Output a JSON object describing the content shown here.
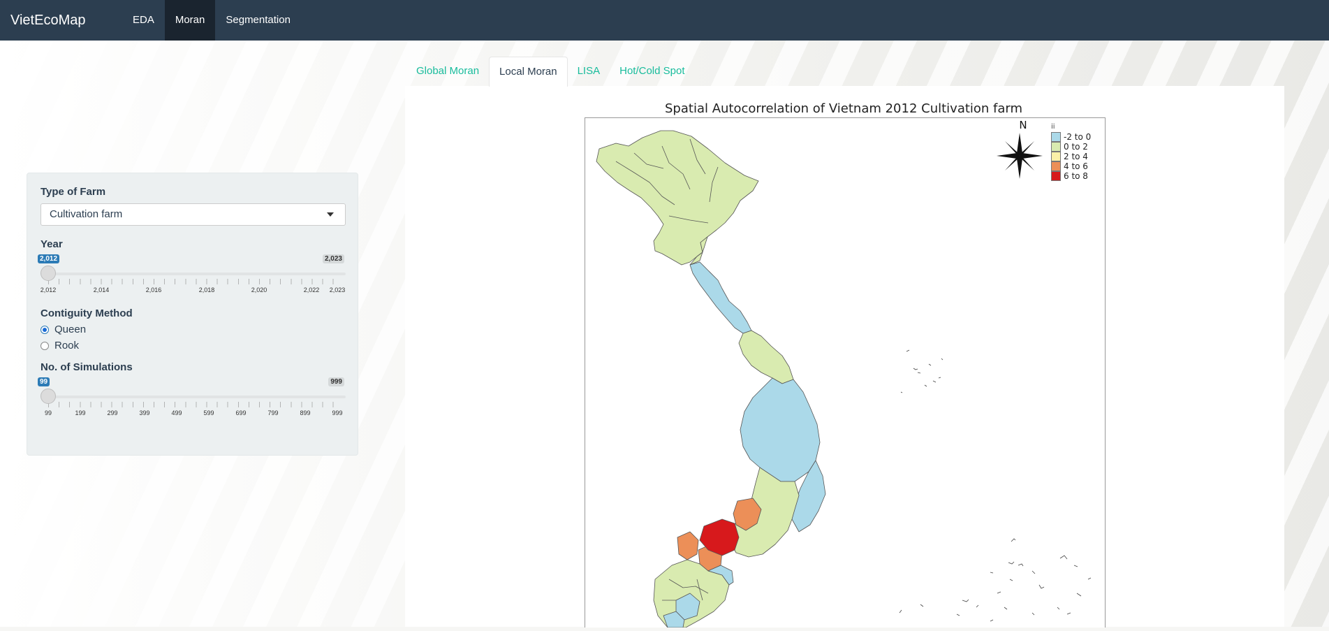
{
  "navbar": {
    "brand": "VietEcoMap",
    "items": [
      {
        "label": "EDA",
        "active": false
      },
      {
        "label": "Moran",
        "active": true
      },
      {
        "label": "Segmentation",
        "active": false
      }
    ]
  },
  "sidebar": {
    "farm_type": {
      "label": "Type of Farm",
      "value": "Cultivation farm"
    },
    "year": {
      "label": "Year",
      "value": "2,012",
      "max": "2,023",
      "ticks": [
        "2,012",
        "2,014",
        "2,016",
        "2,018",
        "2,020",
        "2,022",
        "2,023"
      ]
    },
    "contiguity": {
      "label": "Contiguity Method",
      "options": [
        "Queen",
        "Rook"
      ],
      "selected": "Queen"
    },
    "simulations": {
      "label": "No. of Simulations",
      "value": "99",
      "max": "999",
      "ticks": [
        "99",
        "199",
        "299",
        "399",
        "499",
        "599",
        "699",
        "799",
        "899",
        "999"
      ]
    }
  },
  "tabs": [
    {
      "label": "Global Moran",
      "active": false
    },
    {
      "label": "Local Moran",
      "active": true
    },
    {
      "label": "LISA",
      "active": false
    },
    {
      "label": "Hot/Cold Spot",
      "active": false
    }
  ],
  "map": {
    "title": "Spatial Autocorrelation of Vietnam 2012 Cultivation farm",
    "north_label": "N",
    "legend": {
      "title": "ii",
      "items": [
        {
          "label": "-2 to 0",
          "color": "#abd9e9"
        },
        {
          "label": "0 to 2",
          "color": "#d9ebb0"
        },
        {
          "label": "2 to 4",
          "color": "#fbf0a8"
        },
        {
          "label": "4 to 6",
          "color": "#ec8f58"
        },
        {
          "label": "6 to 8",
          "color": "#d7191c"
        }
      ]
    }
  }
}
